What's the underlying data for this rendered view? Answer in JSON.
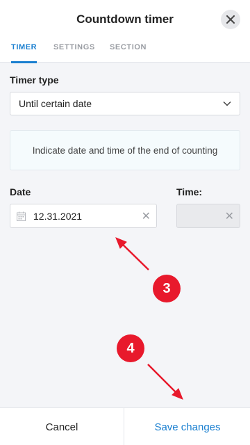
{
  "header": {
    "title": "Countdown timer",
    "close_icon": "close-icon",
    "tabs": [
      {
        "label": "TIMER",
        "active": true
      },
      {
        "label": "SETTINGS",
        "active": false
      },
      {
        "label": "SECTION",
        "active": false
      }
    ]
  },
  "form": {
    "timer_type_label": "Timer type",
    "timer_type_value": "Until certain date",
    "info_text": "Indicate date and time of the end of counting",
    "date_label": "Date",
    "date_value": "12.31.2021",
    "time_label": "Time:",
    "time_value": ""
  },
  "annotations": {
    "badge_3": "3",
    "badge_4": "4",
    "badge_color": "#e8192c"
  },
  "footer": {
    "cancel_label": "Cancel",
    "save_label": "Save changes"
  },
  "colors": {
    "accent": "#1a7fd0",
    "background": "#f4f5f8"
  }
}
